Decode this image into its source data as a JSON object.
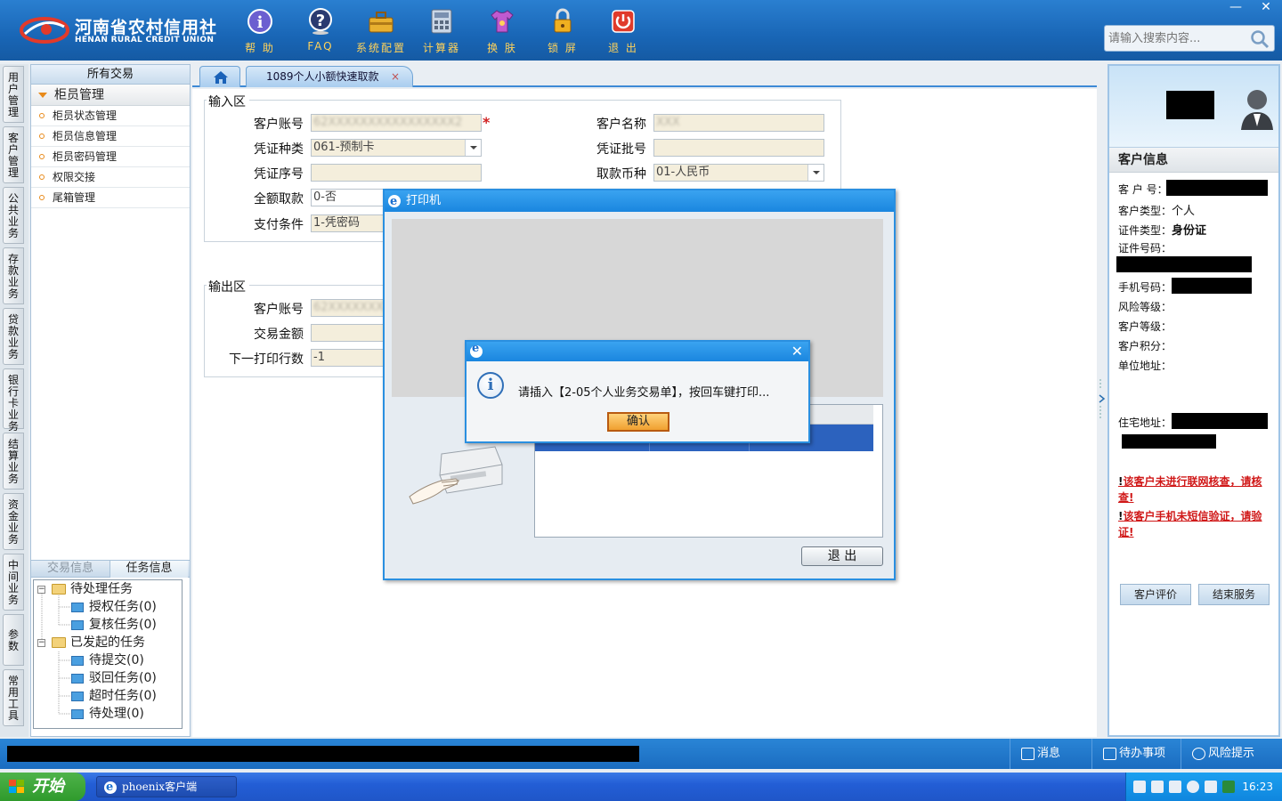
{
  "app": {
    "brand_cn": "河南省农村信用社",
    "brand_en": "HENAN RURAL CREDIT UNION"
  },
  "toolbar": [
    {
      "label": "帮 助",
      "icon": "info-icon"
    },
    {
      "label": "FAQ",
      "icon": "question-icon"
    },
    {
      "label": "系统配置",
      "icon": "toolbox-icon"
    },
    {
      "label": "计算器",
      "icon": "calculator-icon"
    },
    {
      "label": "换 肤",
      "icon": "shirt-icon"
    },
    {
      "label": "锁 屏",
      "icon": "lock-icon"
    },
    {
      "label": "退 出",
      "icon": "power-icon"
    }
  ],
  "search": {
    "placeholder": "请输入搜索内容..."
  },
  "window_controls": {
    "minimize": "—",
    "close": "✕"
  },
  "vtabs": [
    "用户管理",
    "客户管理",
    "公共业务",
    "存款业务",
    "贷款业务",
    "银行卡业务",
    "结算业务",
    "资金业务",
    "中间业务",
    "参数",
    "常用工具"
  ],
  "left_panel": {
    "header": "所有交易",
    "group": "柜员管理",
    "items": [
      "柜员状态管理",
      "柜员信息管理",
      "柜员密码管理",
      "权限交接",
      "尾箱管理"
    ],
    "tabs": [
      "交易信息",
      "任务信息"
    ],
    "tree": {
      "pending": "待处理任务",
      "pending_children": [
        "授权任务(0)",
        "复核任务(0)"
      ],
      "initiated": "已发起的任务",
      "initiated_children": [
        "待提交(0)",
        "驳回任务(0)",
        "超时任务(0)",
        "待处理(0)"
      ]
    }
  },
  "tabs": {
    "active": "1089个人小额快速取款",
    "close": "×"
  },
  "input_area": {
    "title": "输入区",
    "account_label": "客户账号",
    "account_value": "62XXXXXXXXXXXXXXXX2",
    "name_label": "客户名称",
    "name_value": "XXX",
    "voucher_type_label": "凭证种类",
    "voucher_type_value": "061-预制卡",
    "voucher_batch_label": "凭证批号",
    "voucher_seq_label": "凭证序号",
    "currency_label": "取款币种",
    "currency_value": "01-人民币",
    "full_withdraw_label": "全额取款",
    "full_withdraw_value": "0-否",
    "pay_cond_label": "支付条件",
    "pay_cond_value": "1-凭密码"
  },
  "output_area": {
    "title": "输出区",
    "account_label": "客户账号",
    "account_value": "62XXXXXXXXX",
    "amount_label": "交易金额",
    "next_line_label": "下一打印行数",
    "next_line_value": "-1"
  },
  "printer_dialog": {
    "title": "打印机",
    "exit_label": "退  出"
  },
  "message_box": {
    "message": "请插入【2-05个人业务交易单】，按回车键打印...",
    "ok_label": "确认",
    "close": "✕"
  },
  "customer": {
    "header": "客户信息",
    "labels": {
      "number": "客 户 号：",
      "type": "客户类型：",
      "id_type": "证件类型：",
      "id_no": "证件号码：",
      "phone": "手机号码：",
      "risk": "风险等级：",
      "level": "客户等级：",
      "points": "客户积分：",
      "work_addr": "单位地址：",
      "home_addr": "住宅地址："
    },
    "type_value": "个人",
    "id_type_value": "身份证",
    "warning1": "该客户未进行联网核查，请核查!",
    "warning2": "该客户手机未短信验证，请验证!",
    "buttons": [
      "客户评价",
      "结束服务"
    ]
  },
  "statusbar": [
    {
      "label": "消息",
      "icon": "mail-icon"
    },
    {
      "label": "待办事项",
      "icon": "checkbox-icon"
    },
    {
      "label": "风险提示",
      "icon": "speech-icon"
    }
  ],
  "taskbar": {
    "start": "开始",
    "task": "phoenix客户端",
    "clock": "16:23"
  },
  "colors": {
    "header_blue": "#1966b6",
    "accent": "#2a8fe0",
    "toolbar_text": "#ffd25a",
    "warning_red": "#d01818"
  }
}
